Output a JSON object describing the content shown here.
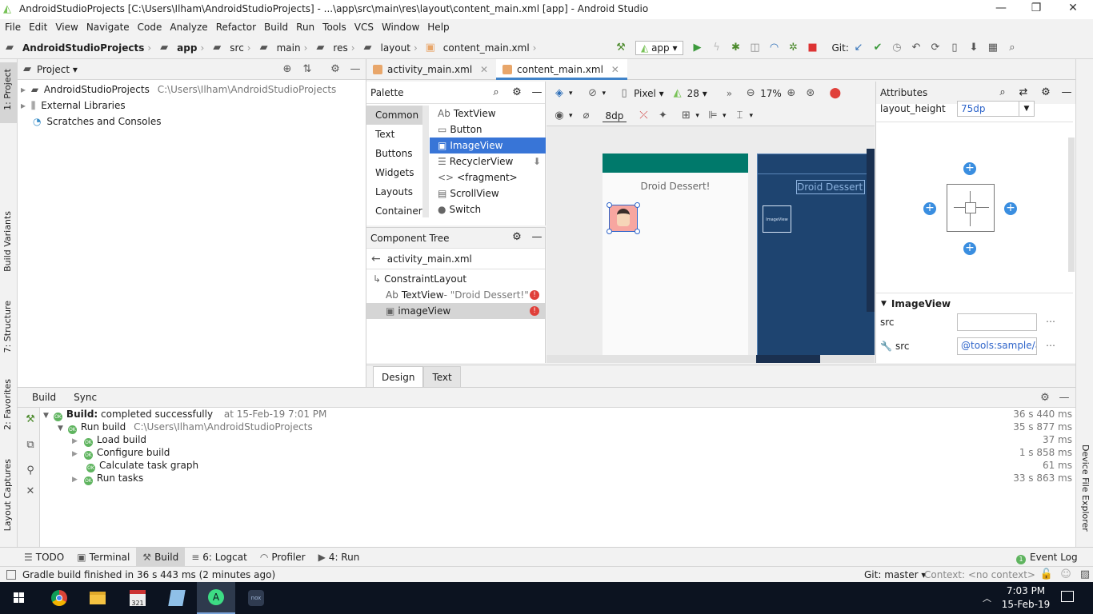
{
  "window": {
    "title": "AndroidStudioProjects [C:\\Users\\Ilham\\AndroidStudioProjects] - ...\\app\\src\\main\\res\\layout\\content_main.xml [app] - Android Studio"
  },
  "menu": [
    "File",
    "Edit",
    "View",
    "Navigate",
    "Code",
    "Analyze",
    "Refactor",
    "Build",
    "Run",
    "Tools",
    "VCS",
    "Window",
    "Help"
  ],
  "breadcrumb": [
    "AndroidStudioProjects",
    "app",
    "src",
    "main",
    "res",
    "layout",
    "content_main.xml"
  ],
  "toolbar": {
    "run_config": "app",
    "git_label": "Git:"
  },
  "left_tabs": [
    "1: Project",
    "Build Variants",
    "7: Structure",
    "2: Favorites",
    "Layout Captures"
  ],
  "right_tabs": [
    "Device File Explorer"
  ],
  "project_panel": {
    "title": "Project",
    "items": [
      {
        "name": "AndroidStudioProjects",
        "path": "C:\\Users\\Ilham\\AndroidStudioProjects"
      },
      {
        "name": "External Libraries",
        "path": ""
      },
      {
        "name": "Scratches and Consoles",
        "path": ""
      }
    ]
  },
  "editor_tabs": [
    {
      "label": "activity_main.xml",
      "active": false
    },
    {
      "label": "content_main.xml",
      "active": true
    }
  ],
  "palette": {
    "title": "Palette",
    "categories": [
      "Common",
      "Text",
      "Buttons",
      "Widgets",
      "Layouts",
      "Container"
    ],
    "items": [
      {
        "icon": "Ab",
        "label": "TextView"
      },
      {
        "icon": "▭",
        "label": "Button"
      },
      {
        "icon": "▣",
        "label": "ImageView"
      },
      {
        "icon": "☰",
        "label": "RecyclerView"
      },
      {
        "icon": "<>",
        "label": "<fragment>"
      },
      {
        "icon": "▤",
        "label": "ScrollView"
      },
      {
        "icon": "●",
        "label": "Switch"
      }
    ]
  },
  "component_tree": {
    "title": "Component Tree",
    "back_label": "activity_main.xml",
    "root": "ConstraintLayout",
    "children": [
      {
        "icon": "Ab",
        "label": "TextView",
        "extra": "- \"Droid Dessert!\""
      },
      {
        "icon": "▣",
        "label": "imageView",
        "extra": ""
      }
    ]
  },
  "design_toolbar": {
    "device": "Pixel",
    "api": "28",
    "zoom": "17%",
    "margin": "8dp"
  },
  "canvas": {
    "text": "Droid Dessert!",
    "blueprint_image_label": "ImageView"
  },
  "attributes": {
    "title": "Attributes",
    "layout_height_label": "layout_height",
    "layout_height_value": "75dp",
    "section": "ImageView",
    "src_label": "src",
    "src_value": "",
    "tools_src_label": "src",
    "tools_src_value": "@tools:sample/av"
  },
  "design_tabs": [
    "Design",
    "Text"
  ],
  "build_panel": {
    "tabs": [
      "Build",
      "Sync"
    ],
    "rows": [
      {
        "bold": "Build:",
        "text": " completed successfully",
        "extra": "at 15-Feb-19 7:01 PM",
        "time": "36 s 440 ms"
      },
      {
        "bold": "",
        "text": "Run build",
        "extra": "C:\\Users\\Ilham\\AndroidStudioProjects",
        "time": "35 s 877 ms"
      },
      {
        "bold": "",
        "text": "Load build",
        "extra": "",
        "time": "37 ms"
      },
      {
        "bold": "",
        "text": "Configure build",
        "extra": "",
        "time": "1 s 858 ms"
      },
      {
        "bold": "",
        "text": "Calculate task graph",
        "extra": "",
        "time": "61 ms"
      },
      {
        "bold": "",
        "text": "Run tasks",
        "extra": "",
        "time": "33 s 863 ms"
      }
    ]
  },
  "tool_tabs": [
    "TODO",
    "Terminal",
    "Build",
    "6: Logcat",
    "Profiler",
    "4: Run"
  ],
  "event_log": "Event Log",
  "status": {
    "message": "Gradle build finished in 36 s 443 ms (2 minutes ago)",
    "git": "Git: master",
    "context": "Context: <no context>"
  },
  "taskbar": {
    "time": "7:03 PM",
    "date": "15-Feb-19"
  },
  "colors": {
    "accent": "#3875d7",
    "toolbar_teal": "#00796b",
    "blueprint": "#1e4470"
  }
}
